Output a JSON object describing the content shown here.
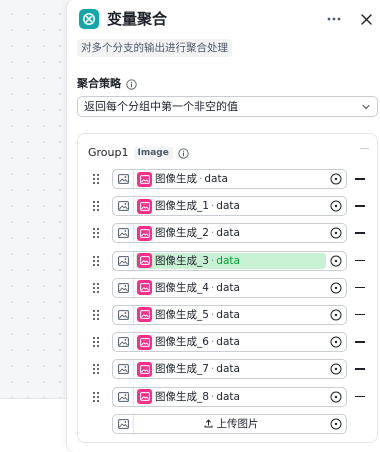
{
  "panel": {
    "title": "变量聚合",
    "description": "对多个分支的输出进行聚合处理",
    "more_icon": "more-icon",
    "close_icon": "close-icon"
  },
  "strategy": {
    "label": "聚合策略",
    "selected": "返回每个分组中第一个非空的值"
  },
  "group": {
    "name": "Group1",
    "type_badge": "Image",
    "variables": [
      {
        "node": "图像生成",
        "sep": "·",
        "field": "data",
        "highlighted": false
      },
      {
        "node": "图像生成_1",
        "sep": "·",
        "field": "data",
        "highlighted": false
      },
      {
        "node": "图像生成_2",
        "sep": "·",
        "field": "data",
        "highlighted": false
      },
      {
        "node": "图像生成_3",
        "sep": "·",
        "field": "data",
        "highlighted": true
      },
      {
        "node": "图像生成_4",
        "sep": "·",
        "field": "data",
        "highlighted": false
      },
      {
        "node": "图像生成_5",
        "sep": "·",
        "field": "data",
        "highlighted": false
      },
      {
        "node": "图像生成_6",
        "sep": "·",
        "field": "data",
        "highlighted": false
      },
      {
        "node": "图像生成_7",
        "sep": "·",
        "field": "data",
        "highlighted": false
      },
      {
        "node": "图像生成_8",
        "sep": "·",
        "field": "data",
        "highlighted": false
      }
    ],
    "upload_label": "上传图片"
  },
  "colors": {
    "node_icon": "#0fa7a7",
    "image_node_badge": "#f5318b",
    "highlight_bg": "#c8f0d2",
    "highlight_text": "#00a136"
  }
}
